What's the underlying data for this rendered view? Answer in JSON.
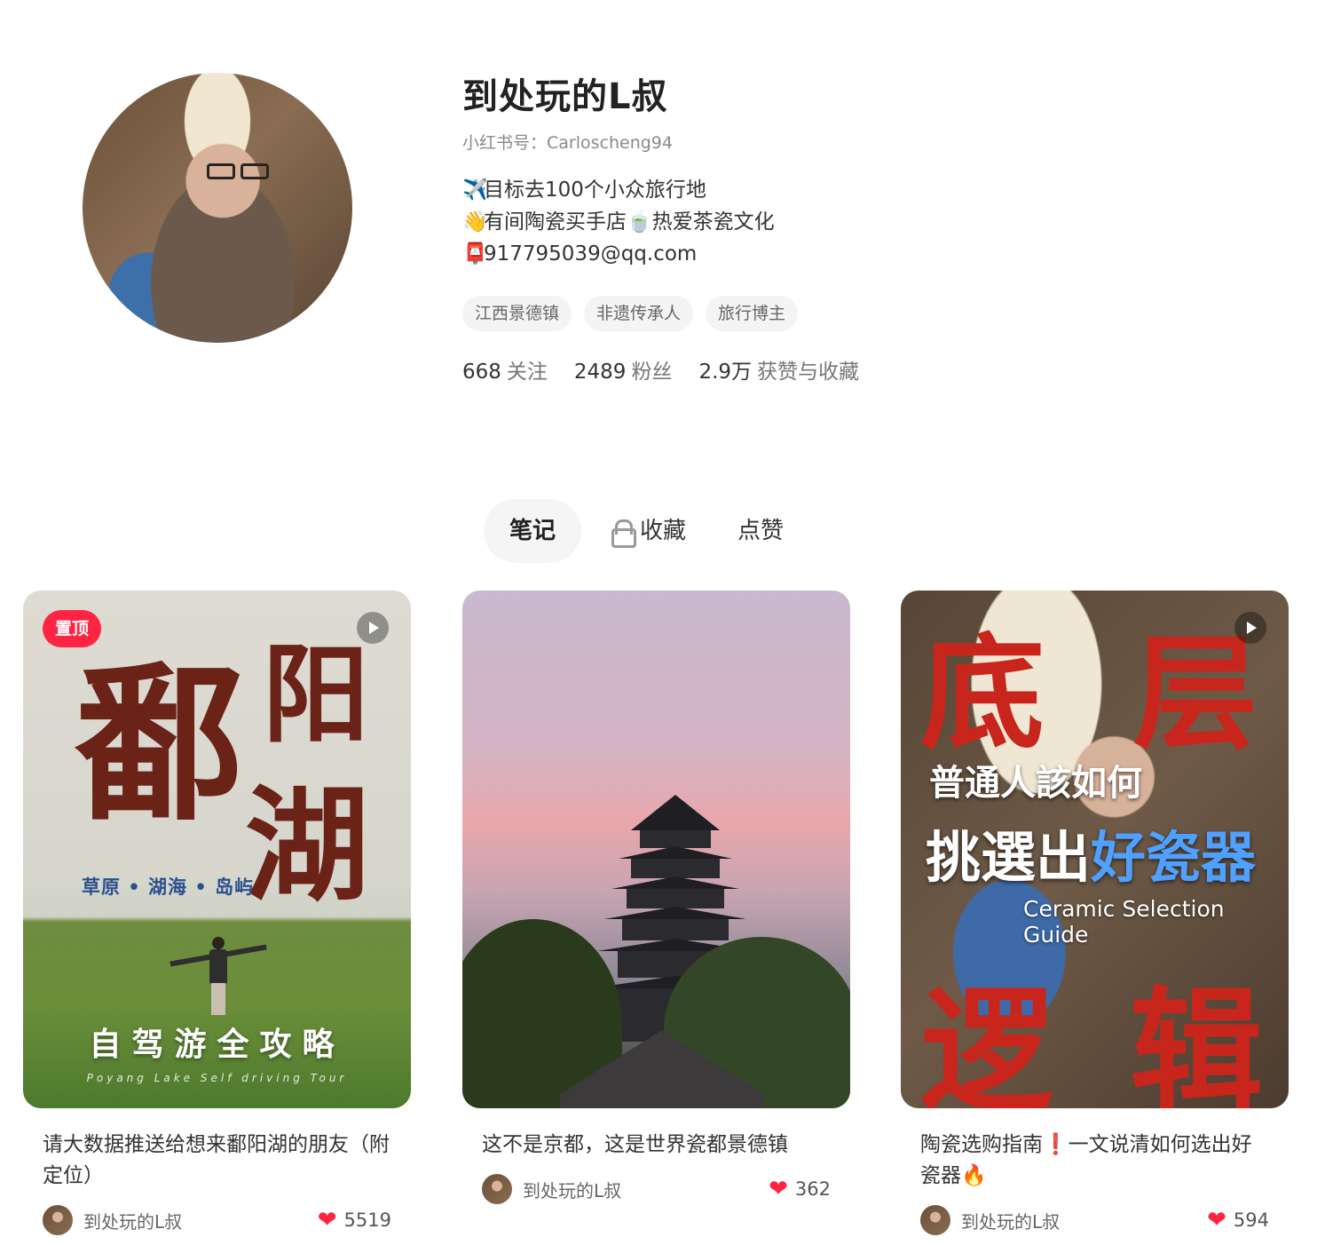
{
  "profile": {
    "nickname": "到处玩的L叔",
    "red_id": "小红书号：Carloscheng94",
    "bio": [
      {
        "emoji": "✈️",
        "text": "目标去100个小众旅行地"
      },
      {
        "emoji": "👋",
        "text": "有间陶瓷买手店🍵热爱茶瓷文化"
      },
      {
        "emoji": "📮",
        "text": "917795039@qq.com"
      }
    ],
    "tags": [
      "江西景德镇",
      "非遗传承人",
      "旅行博主"
    ],
    "stats": [
      {
        "value": "668",
        "label": "关注"
      },
      {
        "value": "2489",
        "label": "粉丝"
      },
      {
        "value": "2.9万",
        "label": "获赞与收藏"
      }
    ]
  },
  "tabs": [
    {
      "label": "笔记",
      "active": true,
      "locked": false
    },
    {
      "label": "收藏",
      "active": false,
      "locked": true
    },
    {
      "label": "点赞",
      "active": false,
      "locked": false
    }
  ],
  "notes": [
    {
      "title": "请大数据推送给想来鄱阳湖的朋友（附定位）",
      "author": "到处玩的L叔",
      "likes": "5519",
      "pinned_label": "置顶",
      "cover": {
        "brush_1": "鄱",
        "brush_2": "阳",
        "brush_3": "湖",
        "subline": "草原 • 湖海 • 岛屿",
        "headline": "自驾游全攻略",
        "caption": "Poyang Lake Self driving Tour"
      }
    },
    {
      "title": "这不是京都，这是世界瓷都景德镇",
      "author": "到处玩的L叔",
      "likes": "362"
    },
    {
      "title": "陶瓷选购指南❗一文说清如何选出好瓷器🔥",
      "author": "到处玩的L叔",
      "likes": "594",
      "cover": {
        "red_1": "底",
        "red_2": "层",
        "red_3": "逻",
        "red_4": "辑",
        "line1": "普通人該如何",
        "line2a": "挑選出",
        "line2b": "好瓷器",
        "line3": "Ceramic Selection Guide"
      }
    }
  ],
  "icons": {
    "heart": "❤",
    "lock": "lock-icon",
    "play": "play-icon"
  },
  "colors": {
    "accent": "#ff2442",
    "text": "#333333",
    "muted": "#8a8a8a"
  }
}
